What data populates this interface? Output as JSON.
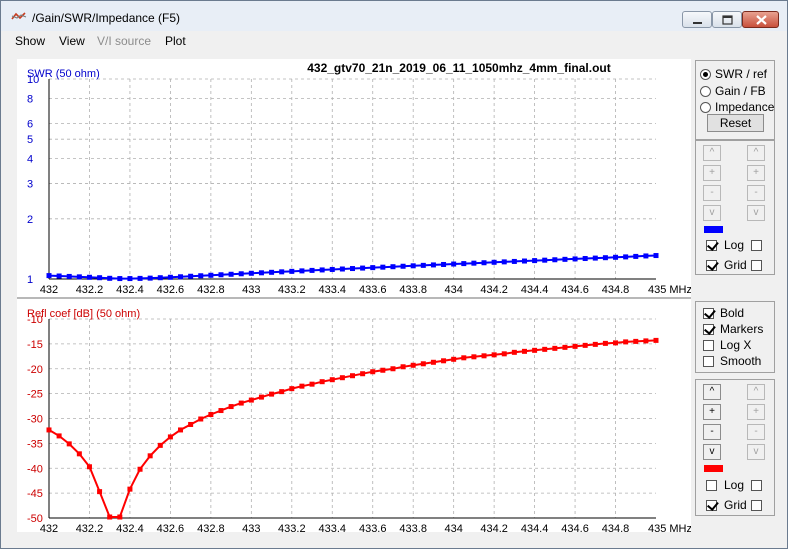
{
  "window": {
    "title": "/Gain/SWR/Impedance (F5)"
  },
  "menu": [
    {
      "label": "Show",
      "enabled": true
    },
    {
      "label": "View",
      "enabled": true
    },
    {
      "label": "V/I source",
      "enabled": false
    },
    {
      "label": "Plot",
      "enabled": true
    }
  ],
  "plot_title": "432_gtv70_21n_2019_06_11_1050mhz_4mm_final.out",
  "side": {
    "modes": [
      "SWR / ref",
      "Gain / FB",
      "Impedance"
    ],
    "selected_mode": "SWR / ref",
    "reset_label": "Reset",
    "scale_buttons": {
      "up": "^",
      "plus": "+",
      "minus": "-",
      "down": "v"
    },
    "log_label": "Log",
    "grid_label": "Grid",
    "bold_label": "Bold",
    "markers_label": "Markers",
    "logx_label": "Log X",
    "smooth_label": "Smooth",
    "top_log": true,
    "top_grid": true,
    "bottom_log": false,
    "bottom_grid": true,
    "bold": true,
    "markers": true,
    "logx": false,
    "smooth": false,
    "color_top": "#0000ff",
    "color_bottom": "#ff0000"
  },
  "chart_data": [
    {
      "type": "line",
      "ylabel": "SWR (50 ohm)",
      "xlabel": "MHz",
      "xlim": [
        432,
        435
      ],
      "ylim": [
        1,
        10
      ],
      "log_y": true,
      "grid": true,
      "x_ticks": [
        "432",
        "432.2",
        "432.4",
        "432.6",
        "432.8",
        "433",
        "433.2",
        "433.4",
        "433.6",
        "433.8",
        "434",
        "434.2",
        "434.4",
        "434.6",
        "434.8",
        "435"
      ],
      "y_ticks": [
        "10",
        "8",
        "6",
        "5",
        "4",
        "3",
        "2",
        "1"
      ],
      "series": [
        {
          "color": "#0000ff",
          "x": [
            432,
            432.05,
            432.1,
            432.15,
            432.2,
            432.25,
            432.3,
            432.35,
            432.4,
            432.45,
            432.5,
            432.55,
            432.6,
            432.65,
            432.7,
            432.75,
            432.8,
            432.85,
            432.9,
            432.95,
            433,
            433.05,
            433.1,
            433.15,
            433.2,
            433.25,
            433.3,
            433.35,
            433.4,
            433.45,
            433.5,
            433.55,
            433.6,
            433.65,
            433.7,
            433.75,
            433.8,
            433.85,
            433.9,
            433.95,
            434,
            434.05,
            434.1,
            434.15,
            434.2,
            434.25,
            434.3,
            434.35,
            434.4,
            434.45,
            434.5,
            434.55,
            434.6,
            434.65,
            434.7,
            434.75,
            434.8,
            434.85,
            434.9,
            434.95,
            435
          ],
          "y": [
            1.04,
            1.035,
            1.03,
            1.025,
            1.02,
            1.015,
            1.008,
            1.005,
            1.005,
            1.007,
            1.01,
            1.015,
            1.02,
            1.026,
            1.032,
            1.038,
            1.044,
            1.05,
            1.056,
            1.062,
            1.068,
            1.074,
            1.08,
            1.086,
            1.092,
            1.098,
            1.104,
            1.11,
            1.116,
            1.122,
            1.128,
            1.134,
            1.14,
            1.146,
            1.152,
            1.158,
            1.164,
            1.17,
            1.176,
            1.182,
            1.188,
            1.194,
            1.2,
            1.206,
            1.212,
            1.218,
            1.224,
            1.23,
            1.236,
            1.242,
            1.248,
            1.254,
            1.26,
            1.266,
            1.272,
            1.278,
            1.284,
            1.29,
            1.297,
            1.304,
            1.31
          ]
        }
      ]
    },
    {
      "type": "line",
      "ylabel": "Refl coef [dB] (50 ohm)",
      "xlabel": "MHz",
      "xlim": [
        432,
        435
      ],
      "ylim": [
        -50,
        -10
      ],
      "log_y": false,
      "grid": true,
      "x_ticks": [
        "432",
        "432.2",
        "432.4",
        "432.6",
        "432.8",
        "433",
        "433.2",
        "433.4",
        "433.6",
        "433.8",
        "434",
        "434.2",
        "434.4",
        "434.6",
        "434.8",
        "435"
      ],
      "y_ticks": [
        "-10",
        "-15",
        "-20",
        "-25",
        "-30",
        "-35",
        "-40",
        "-45",
        "-50"
      ],
      "series": [
        {
          "color": "#ff0000",
          "x": [
            432,
            432.05,
            432.1,
            432.15,
            432.2,
            432.25,
            432.3,
            432.35,
            432.4,
            432.45,
            432.5,
            432.55,
            432.6,
            432.65,
            432.7,
            432.75,
            432.8,
            432.85,
            432.9,
            432.95,
            433,
            433.05,
            433.1,
            433.15,
            433.2,
            433.25,
            433.3,
            433.35,
            433.4,
            433.45,
            433.5,
            433.55,
            433.6,
            433.65,
            433.7,
            433.75,
            433.8,
            433.85,
            433.9,
            433.95,
            434,
            434.05,
            434.1,
            434.15,
            434.2,
            434.25,
            434.3,
            434.35,
            434.4,
            434.45,
            434.5,
            434.55,
            434.6,
            434.65,
            434.7,
            434.75,
            434.8,
            434.85,
            434.9,
            434.95,
            435
          ],
          "y": [
            -32.3,
            -33.5,
            -35.1,
            -37.1,
            -39.7,
            -44.7,
            -49.8,
            -49.8,
            -44.2,
            -40.2,
            -37.5,
            -35.4,
            -33.7,
            -32.3,
            -31.2,
            -30.1,
            -29.2,
            -28.4,
            -27.6,
            -26.9,
            -26.3,
            -25.7,
            -25.1,
            -24.6,
            -24.0,
            -23.5,
            -23.1,
            -22.6,
            -22.2,
            -21.8,
            -21.4,
            -21.0,
            -20.6,
            -20.3,
            -20.0,
            -19.6,
            -19.3,
            -19.0,
            -18.7,
            -18.4,
            -18.1,
            -17.8,
            -17.6,
            -17.4,
            -17.2,
            -17.0,
            -16.7,
            -16.5,
            -16.3,
            -16.1,
            -15.9,
            -15.7,
            -15.5,
            -15.3,
            -15.1,
            -14.9,
            -14.8,
            -14.6,
            -14.5,
            -14.4,
            -14.3
          ]
        }
      ]
    }
  ]
}
